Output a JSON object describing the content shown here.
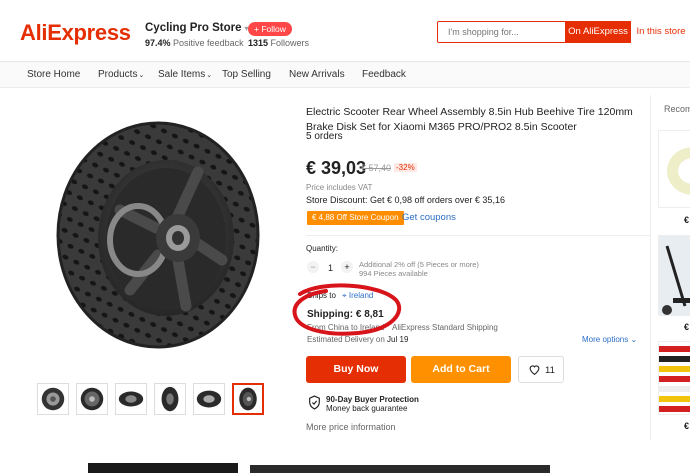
{
  "header": {
    "logo": "AliExpress",
    "store_name": "Cycling Pro Store",
    "feedback_pct": "97.4%",
    "feedback_label": "Positive feedback",
    "follow_label": "+ Follow",
    "followers_count": "1315",
    "followers_label": "Followers",
    "search": {
      "placeholder": "I'm shopping for...",
      "btn_ali": "On AliExpress",
      "btn_store": "In this store"
    }
  },
  "nav": {
    "items": [
      {
        "label": "Store Home",
        "dropdown": false
      },
      {
        "label": "Products",
        "dropdown": true
      },
      {
        "label": "Sale Items",
        "dropdown": true
      },
      {
        "label": "Top Selling",
        "dropdown": false
      },
      {
        "label": "New Arrivals",
        "dropdown": false
      },
      {
        "label": "Feedback",
        "dropdown": false
      }
    ]
  },
  "product": {
    "title": "Electric Scooter Rear Wheel Assembly 8.5in Hub Beehive Tire 120mm Brake Disk Set for Xiaomi M365 PRO/PRO2 8.5in Scooter",
    "orders": "5 orders",
    "price": "€ 39,03",
    "old_price": "€ 57,40",
    "discount": "-32%",
    "vat": "Price includes VAT",
    "store_discount": "Store Discount: Get € 0,98 off orders over € 35,16",
    "coupon": "€ 4,88 Off Store Coupon",
    "get_coupons": "Get coupons",
    "quantity_label": "Quantity:",
    "quantity": "1",
    "qty_note_1": "Additional 2% off (5 Pieces or more)",
    "qty_note_2": "994 Pieces available",
    "ships_to_label": "Ships to",
    "ships_to_location": "Ireland",
    "shipping": "Shipping: € 8,81",
    "ship_from": "From China to Ireland",
    "ship_method": "AliExpress Standard Shipping",
    "delivery_label": "Estimated Delivery on",
    "delivery_date": "Jul 19",
    "more_options": "More options",
    "buy_now": "Buy Now",
    "add_to_cart": "Add to Cart",
    "wishlist_count": "11",
    "protection_title": "90-Day Buyer Protection",
    "protection_sub": "Money back guarantee",
    "more_price_info": "More price information"
  },
  "recommended": {
    "label": "Recomm",
    "prices": [
      "€",
      "€",
      "€"
    ]
  },
  "colors": {
    "brand": "#e62e04",
    "cart": "#ff9100",
    "link": "#2d6fc4",
    "annotation": "#d8141b"
  }
}
